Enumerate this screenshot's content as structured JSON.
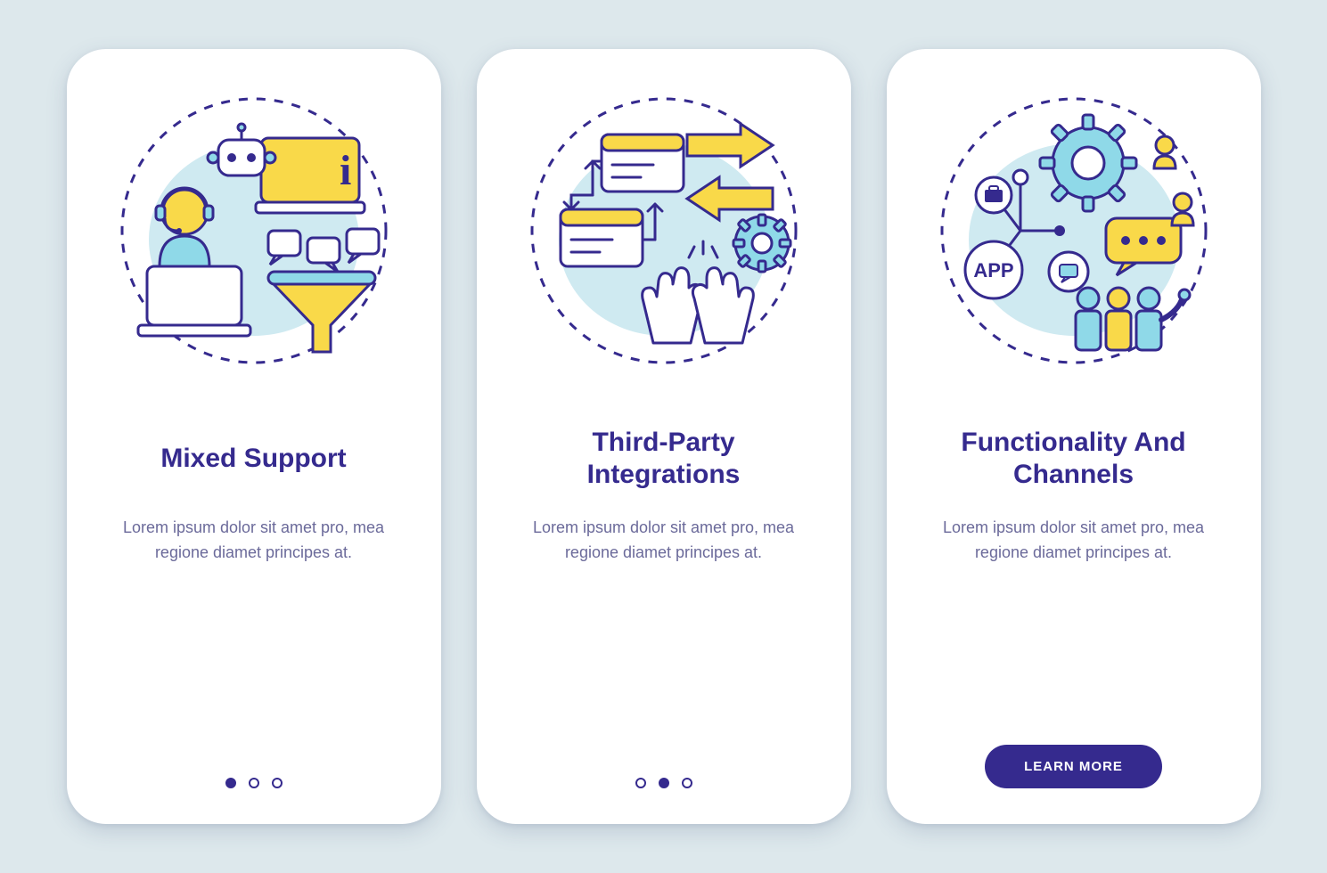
{
  "colors": {
    "background": "#dde8ec",
    "card": "#ffffff",
    "primary": "#352a8e",
    "accentYellow": "#f9d949",
    "accentCyan": "#8fd9e8",
    "textMuted": "#6b6a9a"
  },
  "cards": [
    {
      "id": "mixed-support",
      "title": "Mixed Support",
      "description": "Lorem ipsum dolor sit amet pro, mea regione diamet principes at.",
      "activeDot": 0,
      "hasButton": false
    },
    {
      "id": "third-party",
      "title": "Third-Party Integrations",
      "description": "Lorem ipsum dolor sit amet pro, mea regione diamet principes at.",
      "activeDot": 1,
      "hasButton": false
    },
    {
      "id": "functionality",
      "title": "Functionality And Channels",
      "description": "Lorem ipsum dolor sit amet pro, mea regione diamet principes at.",
      "activeDot": 2,
      "hasButton": true,
      "buttonLabel": "LEARN MORE"
    }
  ],
  "illustration_labels": {
    "app_bubble": "APP"
  }
}
